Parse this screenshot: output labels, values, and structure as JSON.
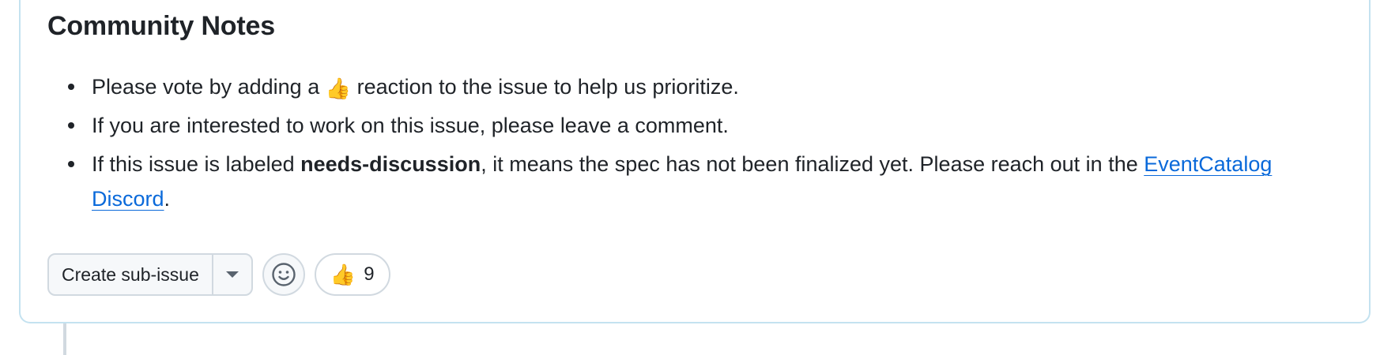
{
  "section": {
    "heading": "Community Notes"
  },
  "notes": {
    "item1": {
      "before": "Please vote by adding a ",
      "emoji": "👍",
      "after": " reaction to the issue to help us prioritize."
    },
    "item2": {
      "text": "If you are interested to work on this issue, please leave a comment."
    },
    "item3": {
      "before": "If this issue is labeled ",
      "bold": "needs-discussion",
      "after": ", it means the spec has not been finalized yet. Please reach out in the ",
      "link": "EventCatalog Discord",
      "end": "."
    }
  },
  "actions": {
    "create_sub_issue_label": "Create sub-issue",
    "dropdown_icon": "triangle-down-icon",
    "add_reaction_icon": "smiley-icon",
    "reaction": {
      "emoji": "👍",
      "count": "9"
    }
  },
  "colors": {
    "border": "#c4e2f0",
    "link": "#0969da",
    "button_bg": "#f6f8fa",
    "button_border": "#d1d9e0"
  }
}
